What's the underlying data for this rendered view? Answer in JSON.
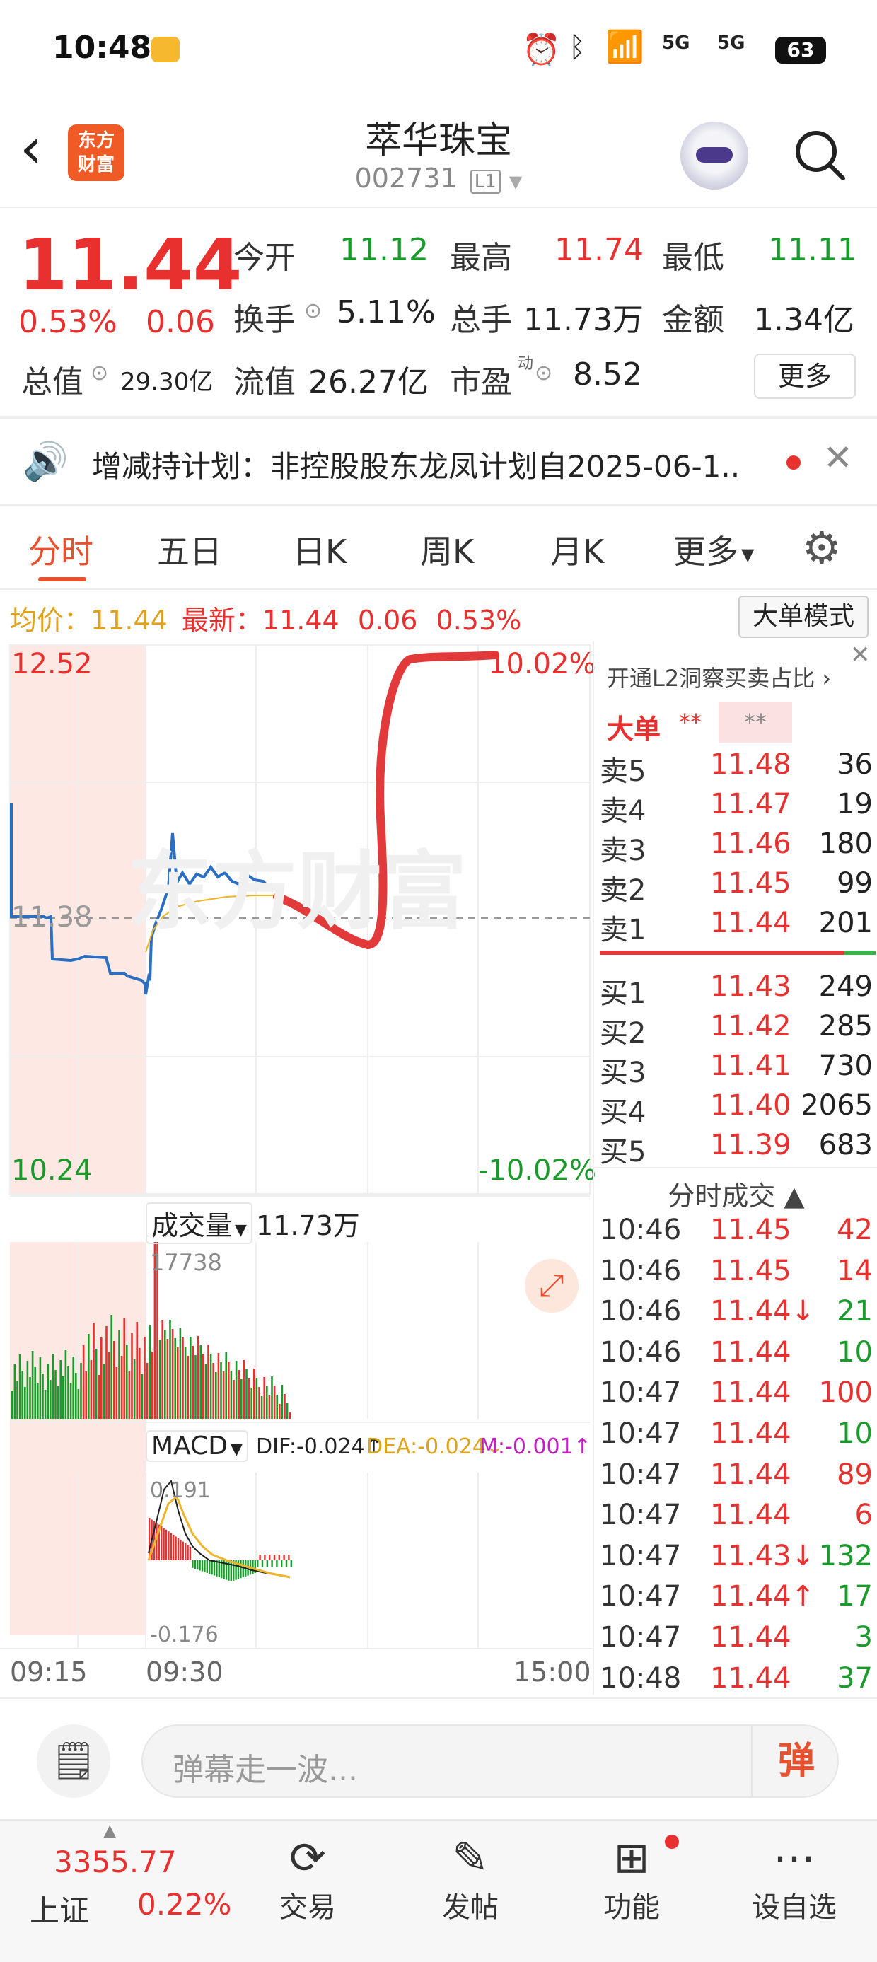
{
  "status_bar": {
    "time": "10:48",
    "battery": "63",
    "network1": "5G",
    "network2": "5G"
  },
  "header": {
    "title": "萃华珠宝",
    "code": "002731",
    "level": "L1",
    "logo_line1": "东方",
    "logo_line2": "财富"
  },
  "quote": {
    "price": "11.44",
    "change_pct": "0.53%",
    "change": "0.06",
    "open_label": "今开",
    "open": "11.12",
    "high_label": "最高",
    "high": "11.74",
    "low_label": "最低",
    "low": "11.11",
    "turnover_label": "换手",
    "turnover": "5.11%",
    "volume_label": "总手",
    "volume": "11.73万",
    "amount_label": "金额",
    "amount": "1.34亿",
    "mktcap_label": "总值",
    "mktcap": "29.30亿",
    "float_label": "流值",
    "float": "26.27亿",
    "pe_label": "市盈",
    "pe_sup": "动",
    "pe": "8.52",
    "more_label": "更多"
  },
  "notice": {
    "text": "增减持计划：非控股股东龙凤计划自2025-06-1.."
  },
  "tabs": [
    "分时",
    "五日",
    "日K",
    "周K",
    "月K",
    "更多"
  ],
  "chart_info": {
    "avg_label": "均价：",
    "avg": "11.44",
    "latest_label": "最新：",
    "latest": "11.44",
    "chg": "0.06",
    "chg_pct": "0.53%",
    "big_order_mode": "大单模式"
  },
  "chart_labels": {
    "top_price": "12.52",
    "top_pct": "10.02%",
    "mid_price": "11.38",
    "bottom_price": "10.24",
    "bottom_pct": "-10.02%",
    "watermark": "东方财富"
  },
  "volume_panel": {
    "label": "成交量",
    "value": "11.73万",
    "max": "17738"
  },
  "macd_panel": {
    "label": "MACD",
    "dif": "DIF:-0.024↑",
    "dea": "DEA:-0.024↓",
    "m": "M:-0.001↑",
    "top": "0.191",
    "bottom": "-0.176"
  },
  "time_axis": {
    "t1": "09:15",
    "t2": "09:30",
    "t3": "15:00"
  },
  "l2_banner": "开通L2洞察买卖占比 ›",
  "big_order": {
    "label": "大单",
    "v1": "**",
    "v2": "**"
  },
  "sells": [
    {
      "label": "卖5",
      "price": "11.48",
      "vol": "36"
    },
    {
      "label": "卖4",
      "price": "11.47",
      "vol": "19"
    },
    {
      "label": "卖3",
      "price": "11.46",
      "vol": "180"
    },
    {
      "label": "卖2",
      "price": "11.45",
      "vol": "99"
    },
    {
      "label": "卖1",
      "price": "11.44",
      "vol": "201"
    }
  ],
  "buys": [
    {
      "label": "买1",
      "price": "11.43",
      "vol": "249"
    },
    {
      "label": "买2",
      "price": "11.42",
      "vol": "285"
    },
    {
      "label": "买3",
      "price": "11.41",
      "vol": "730"
    },
    {
      "label": "买4",
      "price": "11.40",
      "vol": "2065"
    },
    {
      "label": "买5",
      "price": "11.39",
      "vol": "683"
    }
  ],
  "trades_title": "分时成交 ▲",
  "trades": [
    {
      "t": "10:46",
      "p": "11.45",
      "v": "42",
      "pc": "red",
      "vc": "red"
    },
    {
      "t": "10:46",
      "p": "11.45",
      "v": "14",
      "pc": "red",
      "vc": "red"
    },
    {
      "t": "10:46",
      "p": "11.44↓",
      "v": "21",
      "pc": "red",
      "vc": "green"
    },
    {
      "t": "10:46",
      "p": "11.44",
      "v": "10",
      "pc": "red",
      "vc": "green"
    },
    {
      "t": "10:47",
      "p": "11.44",
      "v": "100",
      "pc": "red",
      "vc": "red"
    },
    {
      "t": "10:47",
      "p": "11.44",
      "v": "10",
      "pc": "red",
      "vc": "green"
    },
    {
      "t": "10:47",
      "p": "11.44",
      "v": "89",
      "pc": "red",
      "vc": "red"
    },
    {
      "t": "10:47",
      "p": "11.44",
      "v": "6",
      "pc": "red",
      "vc": "red"
    },
    {
      "t": "10:47",
      "p": "11.43↓",
      "v": "132",
      "pc": "red",
      "vc": "green"
    },
    {
      "t": "10:47",
      "p": "11.44↑",
      "v": "17",
      "pc": "red",
      "vc": "green"
    },
    {
      "t": "10:47",
      "p": "11.44",
      "v": "3",
      "pc": "red",
      "vc": "green"
    },
    {
      "t": "10:48",
      "p": "11.44",
      "v": "37",
      "pc": "red",
      "vc": "green"
    }
  ],
  "comment": {
    "placeholder": "弹幕走一波...",
    "danmu_label": "弹"
  },
  "footer": {
    "index_value": "3355.77",
    "index_name": "上证",
    "index_pct": "0.22%",
    "trade": "交易",
    "post": "发帖",
    "func": "功能",
    "watch": "设自选"
  },
  "colors": {
    "up": "#e8312f",
    "down": "#1a9a2b",
    "accent": "#e8512f",
    "line": "#2a6fc4",
    "avg": "#f0b429"
  }
}
